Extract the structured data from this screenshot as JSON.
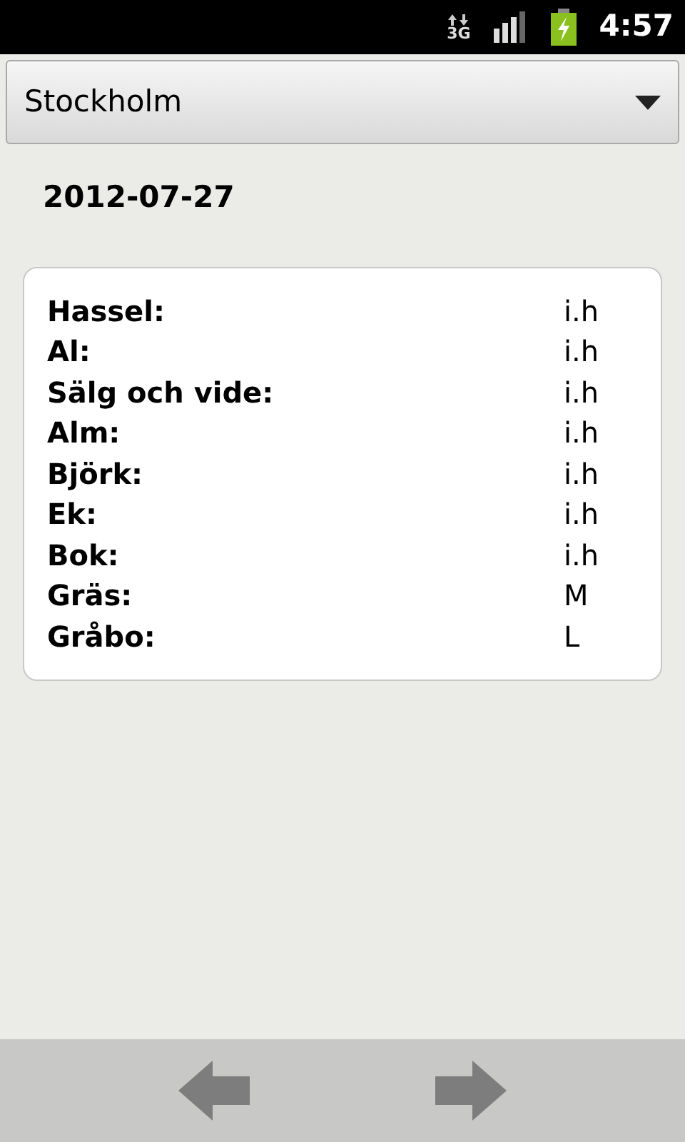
{
  "status_bar": {
    "network": "3G",
    "time": "4:57"
  },
  "spinner": {
    "value": "Stockholm"
  },
  "date": "2012-07-27",
  "pollen": [
    {
      "name": "Hassel:",
      "level": "i.h"
    },
    {
      "name": "Al:",
      "level": "i.h"
    },
    {
      "name": "Sälg och vide:",
      "level": "i.h"
    },
    {
      "name": "Alm:",
      "level": "i.h"
    },
    {
      "name": "Björk:",
      "level": "i.h"
    },
    {
      "name": "Ek:",
      "level": "i.h"
    },
    {
      "name": "Bok:",
      "level": "i.h"
    },
    {
      "name": "Gräs:",
      "level": "M"
    },
    {
      "name": "Gråbo:",
      "level": "L"
    }
  ]
}
